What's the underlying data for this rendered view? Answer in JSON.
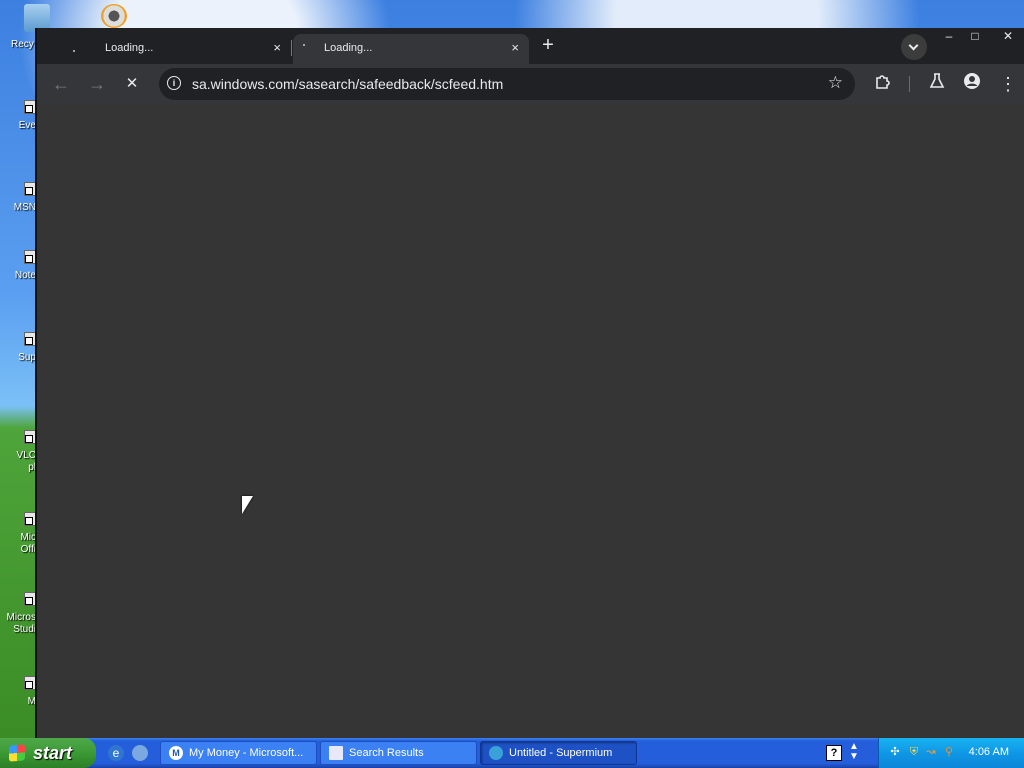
{
  "desktop": {
    "recycle_label": "Recy",
    "icons": [
      "Eve",
      "MSN",
      "Note",
      "Sup",
      "VLC\npl",
      "Mic\nOffi",
      "Micros\nStudi",
      "M"
    ]
  },
  "browser": {
    "tabs": [
      {
        "title": "Loading...",
        "close": "×"
      },
      {
        "title": "Loading...",
        "close": "×"
      }
    ],
    "new_tab": "+",
    "window_controls": {
      "minimize": "–",
      "maximize": "□",
      "close": "✕"
    },
    "toolbar": {
      "back": "←",
      "forward": "→",
      "stop": "✕",
      "url": "sa.windows.com/sasearch/safeedback/scfeed.htm",
      "star": "☆",
      "extensions_icon": "puzzle-icon",
      "labs_icon": "flask-icon",
      "profile_icon": "person-icon",
      "menu": "⋮"
    }
  },
  "taskbar": {
    "start_label": "start",
    "tasks": [
      {
        "label": "My Money - Microsoft...",
        "icon": "M"
      },
      {
        "label": "Search Results",
        "icon": ""
      },
      {
        "label": "Untitled - Supermium",
        "icon": ""
      }
    ],
    "clock": "4:06 AM",
    "help": "?"
  }
}
